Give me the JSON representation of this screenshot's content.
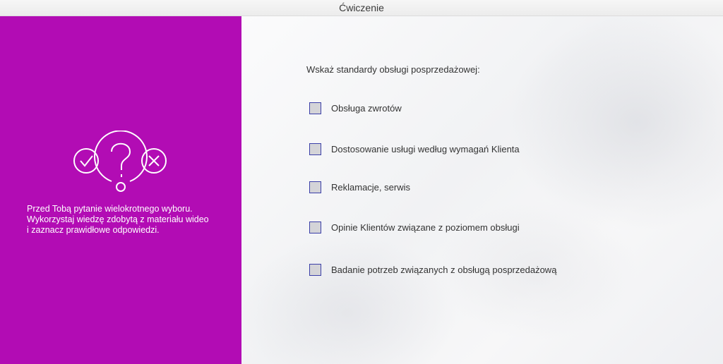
{
  "window": {
    "title": "Ćwiczenie"
  },
  "left_panel": {
    "accent_color": "#b20cb4",
    "icons": [
      "checkmark-circle-icon",
      "question-bubble-icon",
      "cross-circle-icon"
    ],
    "instructions": [
      "Przed Tobą pytanie wielokrotnego wyboru.",
      "Wykorzystaj wiedzę zdobytą z materiału wideo",
      "i zaznacz prawidłowe odpowiedzi."
    ]
  },
  "exercise": {
    "question": "Wskaż standardy obsługi posprzedażowej:",
    "options": [
      {
        "label": "Obsługa zwrotów",
        "checked": false
      },
      {
        "label": "Dostosowanie usługi według wymagań Klienta",
        "checked": false
      },
      {
        "label": "Reklamacje, serwis",
        "checked": false
      },
      {
        "label": "Opinie Klientów związane z poziomem obsługi",
        "checked": false
      },
      {
        "label": "Badanie potrzeb związanych z obsługą posprzedażową",
        "checked": false
      }
    ]
  }
}
